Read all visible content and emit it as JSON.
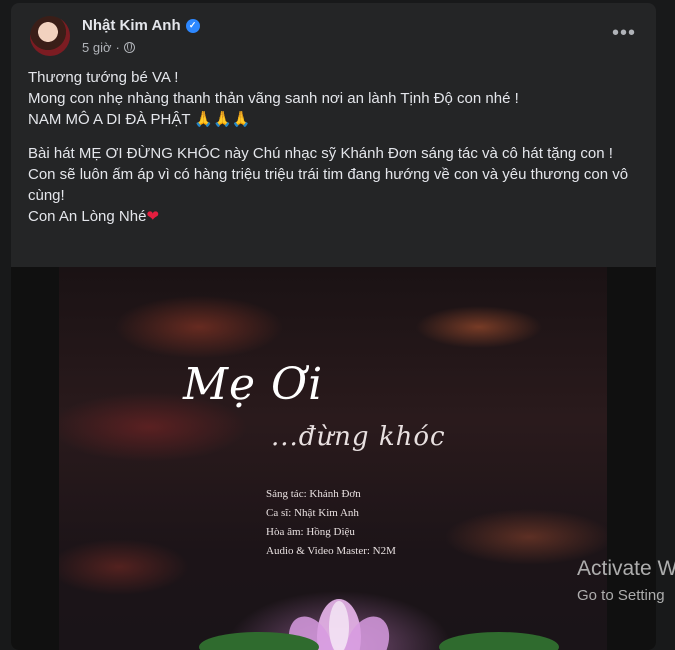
{
  "post": {
    "author": "Nhật Kim Anh",
    "time": "5 giờ",
    "separator": "·",
    "more": "•••",
    "paragraphs": [
      [
        "Thương tướng bé VA !",
        "Mong con nhẹ nhàng thanh thản vãng sanh nơi an lành Tịnh Độ con nhé !",
        "NAM MÔ A DI ĐÀ PHẬT 🙏🙏🙏"
      ],
      [
        "Bài hát MẸ ƠI ĐỪNG KHÓC này Chú nhạc sỹ Khánh Đơn sáng tác và cô hát tặng con !",
        "Con sẽ luôn ấm áp vì có hàng triệu triệu trái tim đang hướng về con và yêu thương con vô cùng!",
        "Con An Lòng Nhé"
      ]
    ],
    "heart": "❤"
  },
  "video": {
    "title": "Mẹ Ơi",
    "subtitle": "...đừng khóc",
    "credits": [
      "Sáng tác:  Khánh Đơn",
      "Ca sĩ:  Nhật Kim Anh",
      "Hòa âm:  Hồng Diệu",
      "Audio & Video Master:  N2M"
    ]
  },
  "watermark": {
    "line1": "Activate Wi",
    "line2": "Go to Setting"
  },
  "colors": {
    "background": "#18191a",
    "card": "#242526",
    "text": "#e4e6eb",
    "secondary": "#b0b3b8",
    "verified": "#2d88ff",
    "heart": "#e41e3f"
  },
  "icons": [
    "verified-icon",
    "globe-icon",
    "more-icon"
  ]
}
